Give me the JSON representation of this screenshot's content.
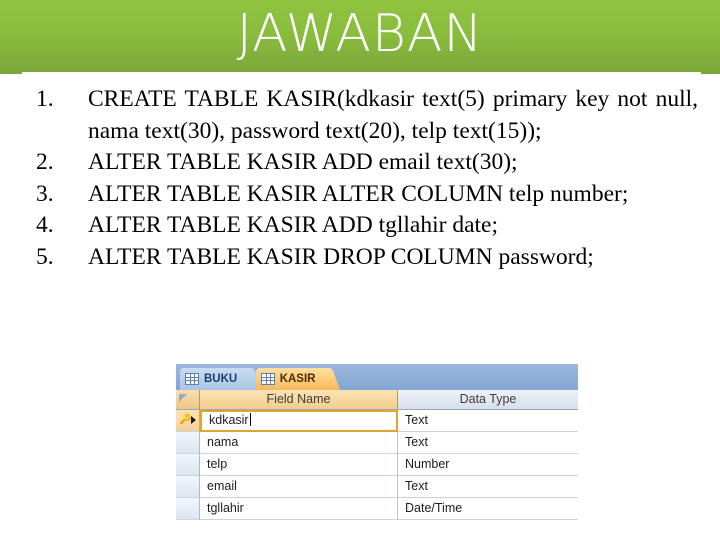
{
  "slide": {
    "title": "JAWABAN",
    "title_color": "#ffffff",
    "band_color_top": "#8fc33f",
    "band_color_bottom": "#7ba63a"
  },
  "steps": [
    {
      "number": "1.",
      "text": "CREATE TABLE KASIR(kdkasir text(5) primary key not null, nama text(30), password text(20), telp text(15));",
      "multiline": true
    },
    {
      "number": "2.",
      "text": "ALTER TABLE KASIR ADD email text(30);",
      "multiline": false
    },
    {
      "number": "3.",
      "text": "ALTER TABLE KASIR ALTER COLUMN telp number;",
      "multiline": true
    },
    {
      "number": "4.",
      "text": "ALTER TABLE KASIR ADD tgllahir date;",
      "multiline": false
    },
    {
      "number": "5.",
      "text": "ALTER TABLE KASIR DROP COLUMN password;",
      "multiline": false
    }
  ],
  "access": {
    "tabs": [
      {
        "label": "BUKU",
        "active": false,
        "icon": "table-grid-icon"
      },
      {
        "label": "KASIR",
        "active": true,
        "icon": "table-grid-icon"
      }
    ],
    "columns": {
      "field_name": "Field Name",
      "data_type": "Data Type"
    },
    "rows": [
      {
        "field": "kdkasir",
        "type": "Text",
        "primary_key": true,
        "current": true
      },
      {
        "field": "nama",
        "type": "Text",
        "primary_key": false,
        "current": false
      },
      {
        "field": "telp",
        "type": "Number",
        "primary_key": false,
        "current": false
      },
      {
        "field": "email",
        "type": "Text",
        "primary_key": false,
        "current": false
      },
      {
        "field": "tgllahir",
        "type": "Date/Time",
        "primary_key": false,
        "current": false
      }
    ]
  }
}
